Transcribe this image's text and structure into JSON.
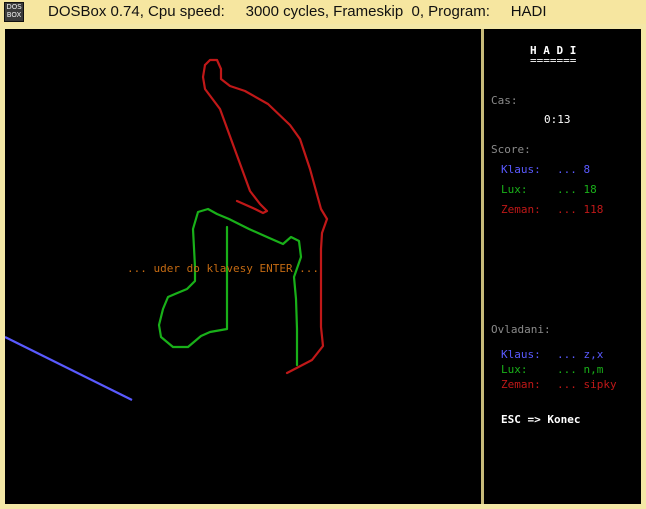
{
  "window": {
    "title": "DOSBox 0.74, Cpu speed:     3000 cycles, Frameskip  0, Program:     HADI",
    "icon_text": "DOS BOX"
  },
  "game": {
    "message": "... uder do klavesy ENTER ..."
  },
  "panel": {
    "title": "H A D I",
    "title_underline": "=======",
    "time_label": "Cas:",
    "time_value": "0:13",
    "score_label": "Score:",
    "players": [
      {
        "name": "Klaus:",
        "score": "... 8",
        "keys": "... z,x",
        "color": "#5a5aff"
      },
      {
        "name": "Lux:",
        "score": "... 18",
        "keys": "... n,m",
        "color": "#19b019"
      },
      {
        "name": "Zeman:",
        "score": "... 118",
        "keys": "... sipky",
        "color": "#c01818"
      }
    ],
    "controls_label": "Ovladani:",
    "esc_text": "ESC => Konec"
  },
  "colors": {
    "label_gray": "#8a8a8a",
    "message_orange": "#c46a12",
    "white": "#ffffff"
  }
}
